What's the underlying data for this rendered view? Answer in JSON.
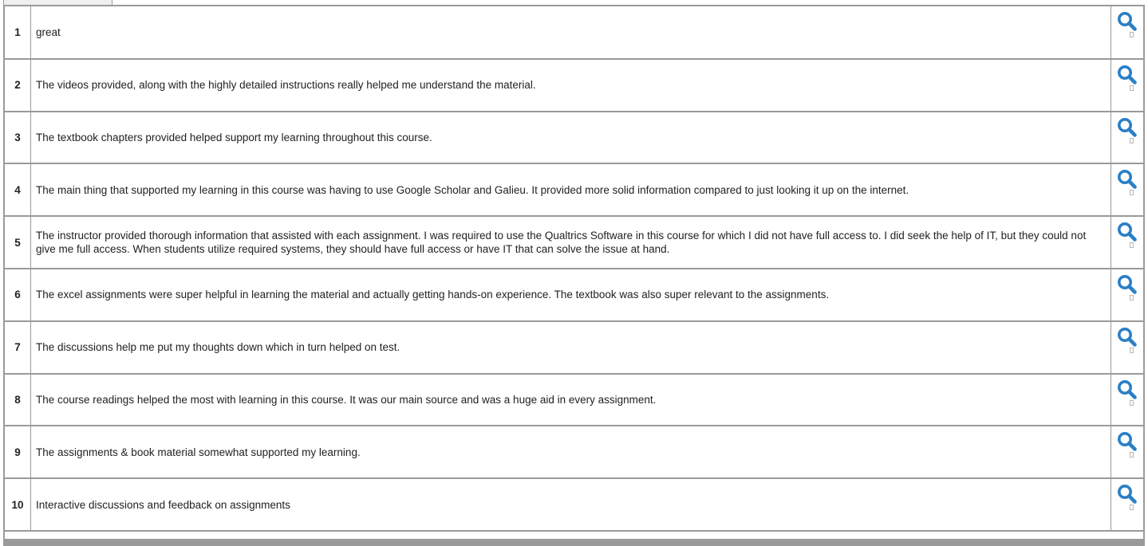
{
  "rows": [
    {
      "num": "1",
      "text": "great"
    },
    {
      "num": "2",
      "text": "The videos provided, along with the highly detailed instructions really helped me understand the material."
    },
    {
      "num": "3",
      "text": "The textbook chapters provided helped support my learning throughout this course."
    },
    {
      "num": "4",
      "text": "The main thing that supported my learning in this course was having to use Google Scholar and Galieu. It provided more solid information compared to just looking it up on the internet."
    },
    {
      "num": "5",
      "text": "The instructor provided thorough information that assisted with each assignment. I was required to use the Qualtrics Software in this course for which I did not have full access to. I did seek the help of IT, but they could not give me full access. When students utilize required systems, they should have full access or have IT that can solve the issue at hand."
    },
    {
      "num": "6",
      "text": "The excel assignments were super helpful in learning the material and actually getting hands-on experience. The textbook was also super relevant to the assignments."
    },
    {
      "num": "7",
      "text": "The discussions help me put my thoughts down which in turn helped on test."
    },
    {
      "num": "8",
      "text": "The course readings helped the most with learning in this course. It was our main source and was a huge aid in every assignment."
    },
    {
      "num": "9",
      "text": "The assignments & book material somewhat supported my learning."
    },
    {
      "num": "10",
      "text": "Interactive discussions and feedback on assignments"
    }
  ],
  "row_action_icon": "magnifier-icon",
  "colors": {
    "icon": "#2a7fc6",
    "border": "#9a9a9a"
  }
}
